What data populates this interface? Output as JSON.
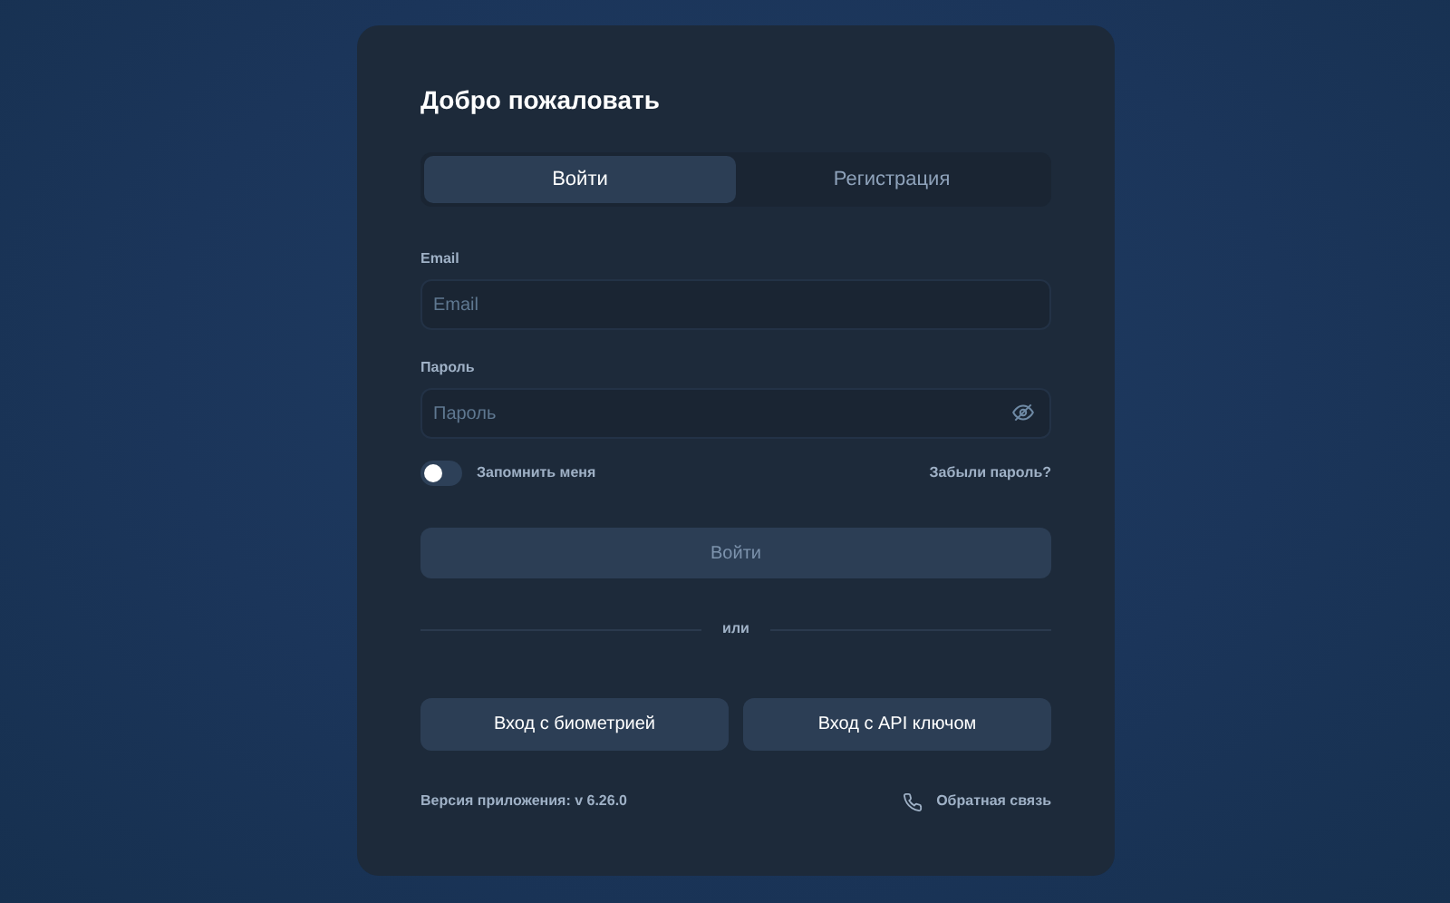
{
  "title": "Добро пожаловать",
  "tabs": [
    {
      "label": "Войти",
      "selected": true
    },
    {
      "label": "Регистрация",
      "selected": false
    }
  ],
  "fields": [
    {
      "label": "Email",
      "placeholder": "Email",
      "kind": "text"
    },
    {
      "label": "Пароль",
      "placeholder": "Пароль",
      "kind": "password"
    }
  ],
  "remember": {
    "label": "Запомнить меня",
    "on": false
  },
  "forgot_link": "Забыли пароль?",
  "submit": {
    "label": "Войти",
    "disabled": true
  },
  "divider": "или",
  "alt_buttons": [
    "Вход с биометрией",
    "Вход с API ключом"
  ],
  "version": "Версия приложения: v 6.26.0",
  "feedback_link": "Обратная связь"
}
